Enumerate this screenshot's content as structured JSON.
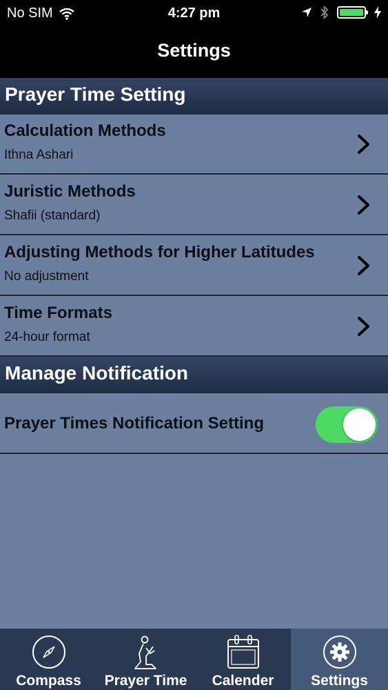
{
  "status": {
    "carrier": "No SIM",
    "time": "4:27 pm",
    "battery_level": 1.0
  },
  "nav": {
    "title": "Settings"
  },
  "prayer_section": {
    "header": "Prayer Time Setting",
    "rows": [
      {
        "title": "Calculation Methods",
        "value": "Ithna Ashari"
      },
      {
        "title": "Juristic Methods",
        "value": "Shafii (standard)"
      },
      {
        "title": "Adjusting Methods for Higher Latitudes",
        "value": "No adjustment"
      },
      {
        "title": "Time Formats",
        "value": "24-hour format"
      }
    ]
  },
  "notification_section": {
    "header": "Manage Notification",
    "toggle_label": "Prayer Times Notification Setting",
    "toggle_on": true
  },
  "tabs": [
    {
      "label": "Compass",
      "icon": "compass-icon",
      "active": false
    },
    {
      "label": "Prayer Time",
      "icon": "praying-person-icon",
      "active": false
    },
    {
      "label": "Calender",
      "icon": "calendar-icon",
      "active": false
    },
    {
      "label": "Settings",
      "icon": "gear-icon",
      "active": true
    }
  ],
  "colors": {
    "accent_toggle": "#4cd964",
    "background": "#6d7f9e",
    "header": "#2b3a56",
    "tabbar": "#2a3852"
  }
}
